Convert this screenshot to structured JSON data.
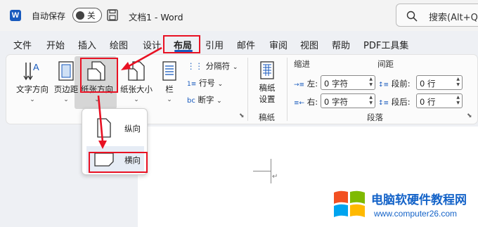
{
  "titlebar": {
    "app_logo": "W",
    "autosave_label": "自动保存",
    "autosave_state": "关",
    "doc_title": "文档1 - Word",
    "search_placeholder": "搜索(Alt+Q"
  },
  "tabs": [
    {
      "label": "文件"
    },
    {
      "label": "开始"
    },
    {
      "label": "插入"
    },
    {
      "label": "绘图"
    },
    {
      "label": "设计"
    },
    {
      "label": "布局",
      "active": true
    },
    {
      "label": "引用"
    },
    {
      "label": "邮件"
    },
    {
      "label": "审阅"
    },
    {
      "label": "视图"
    },
    {
      "label": "帮助"
    },
    {
      "label": "PDF工具集"
    }
  ],
  "ribbon": {
    "page_setup": {
      "text_direction": "文字方向",
      "margins": "页边距",
      "orientation": "纸张方向",
      "size": "纸张大小",
      "columns": "栏",
      "breaks": "分隔符",
      "line_numbers": "行号",
      "hyphenation": "断字"
    },
    "manuscript": {
      "settings_line1": "稿纸",
      "settings_line2": "设置",
      "group_label": "稿纸"
    },
    "paragraph": {
      "indent_header": "缩进",
      "spacing_header": "间距",
      "indent_left_label": "左:",
      "indent_left_value": "0 字符",
      "indent_right_label": "右:",
      "indent_right_value": "0 字符",
      "spacing_before_label": "段前:",
      "spacing_before_value": "0 行",
      "spacing_after_label": "段后:",
      "spacing_after_value": "0 行",
      "group_label": "段落"
    }
  },
  "orientation_menu": {
    "portrait": "纵向",
    "landscape": "横向",
    "selected": "landscape"
  },
  "watermark": {
    "title": "电脑软硬件教程网",
    "url": "www.computer26.com"
  },
  "colors": {
    "accent": "#185abd",
    "annotation_red": "#e81123",
    "watermark_blue": "#1463c8"
  }
}
